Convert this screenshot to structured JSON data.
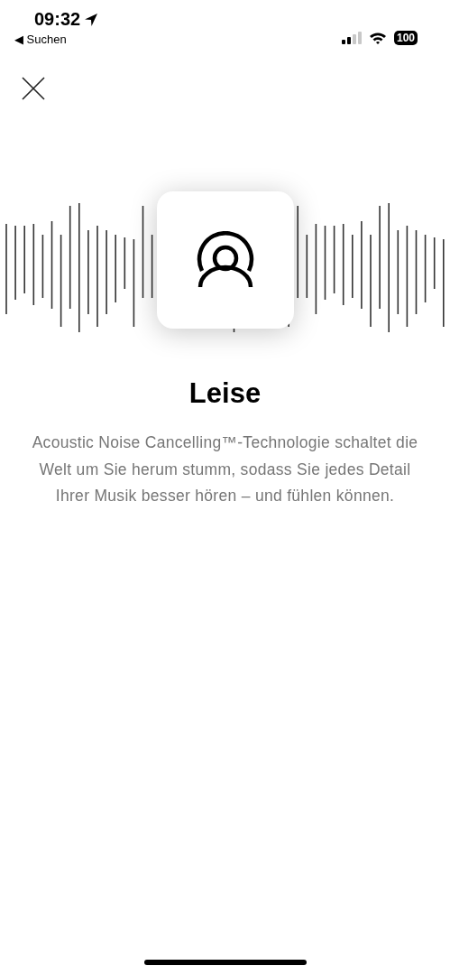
{
  "status_bar": {
    "time": "09:32",
    "back_label": "◀ Suchen",
    "battery": "100"
  },
  "feature": {
    "title": "Leise",
    "description": "Acoustic Noise Cancelling™-Technologie schaltet die Welt um Sie herum stumm, sodass Sie jedes Detail Ihrer Musik besser hören – und fühlen können."
  }
}
